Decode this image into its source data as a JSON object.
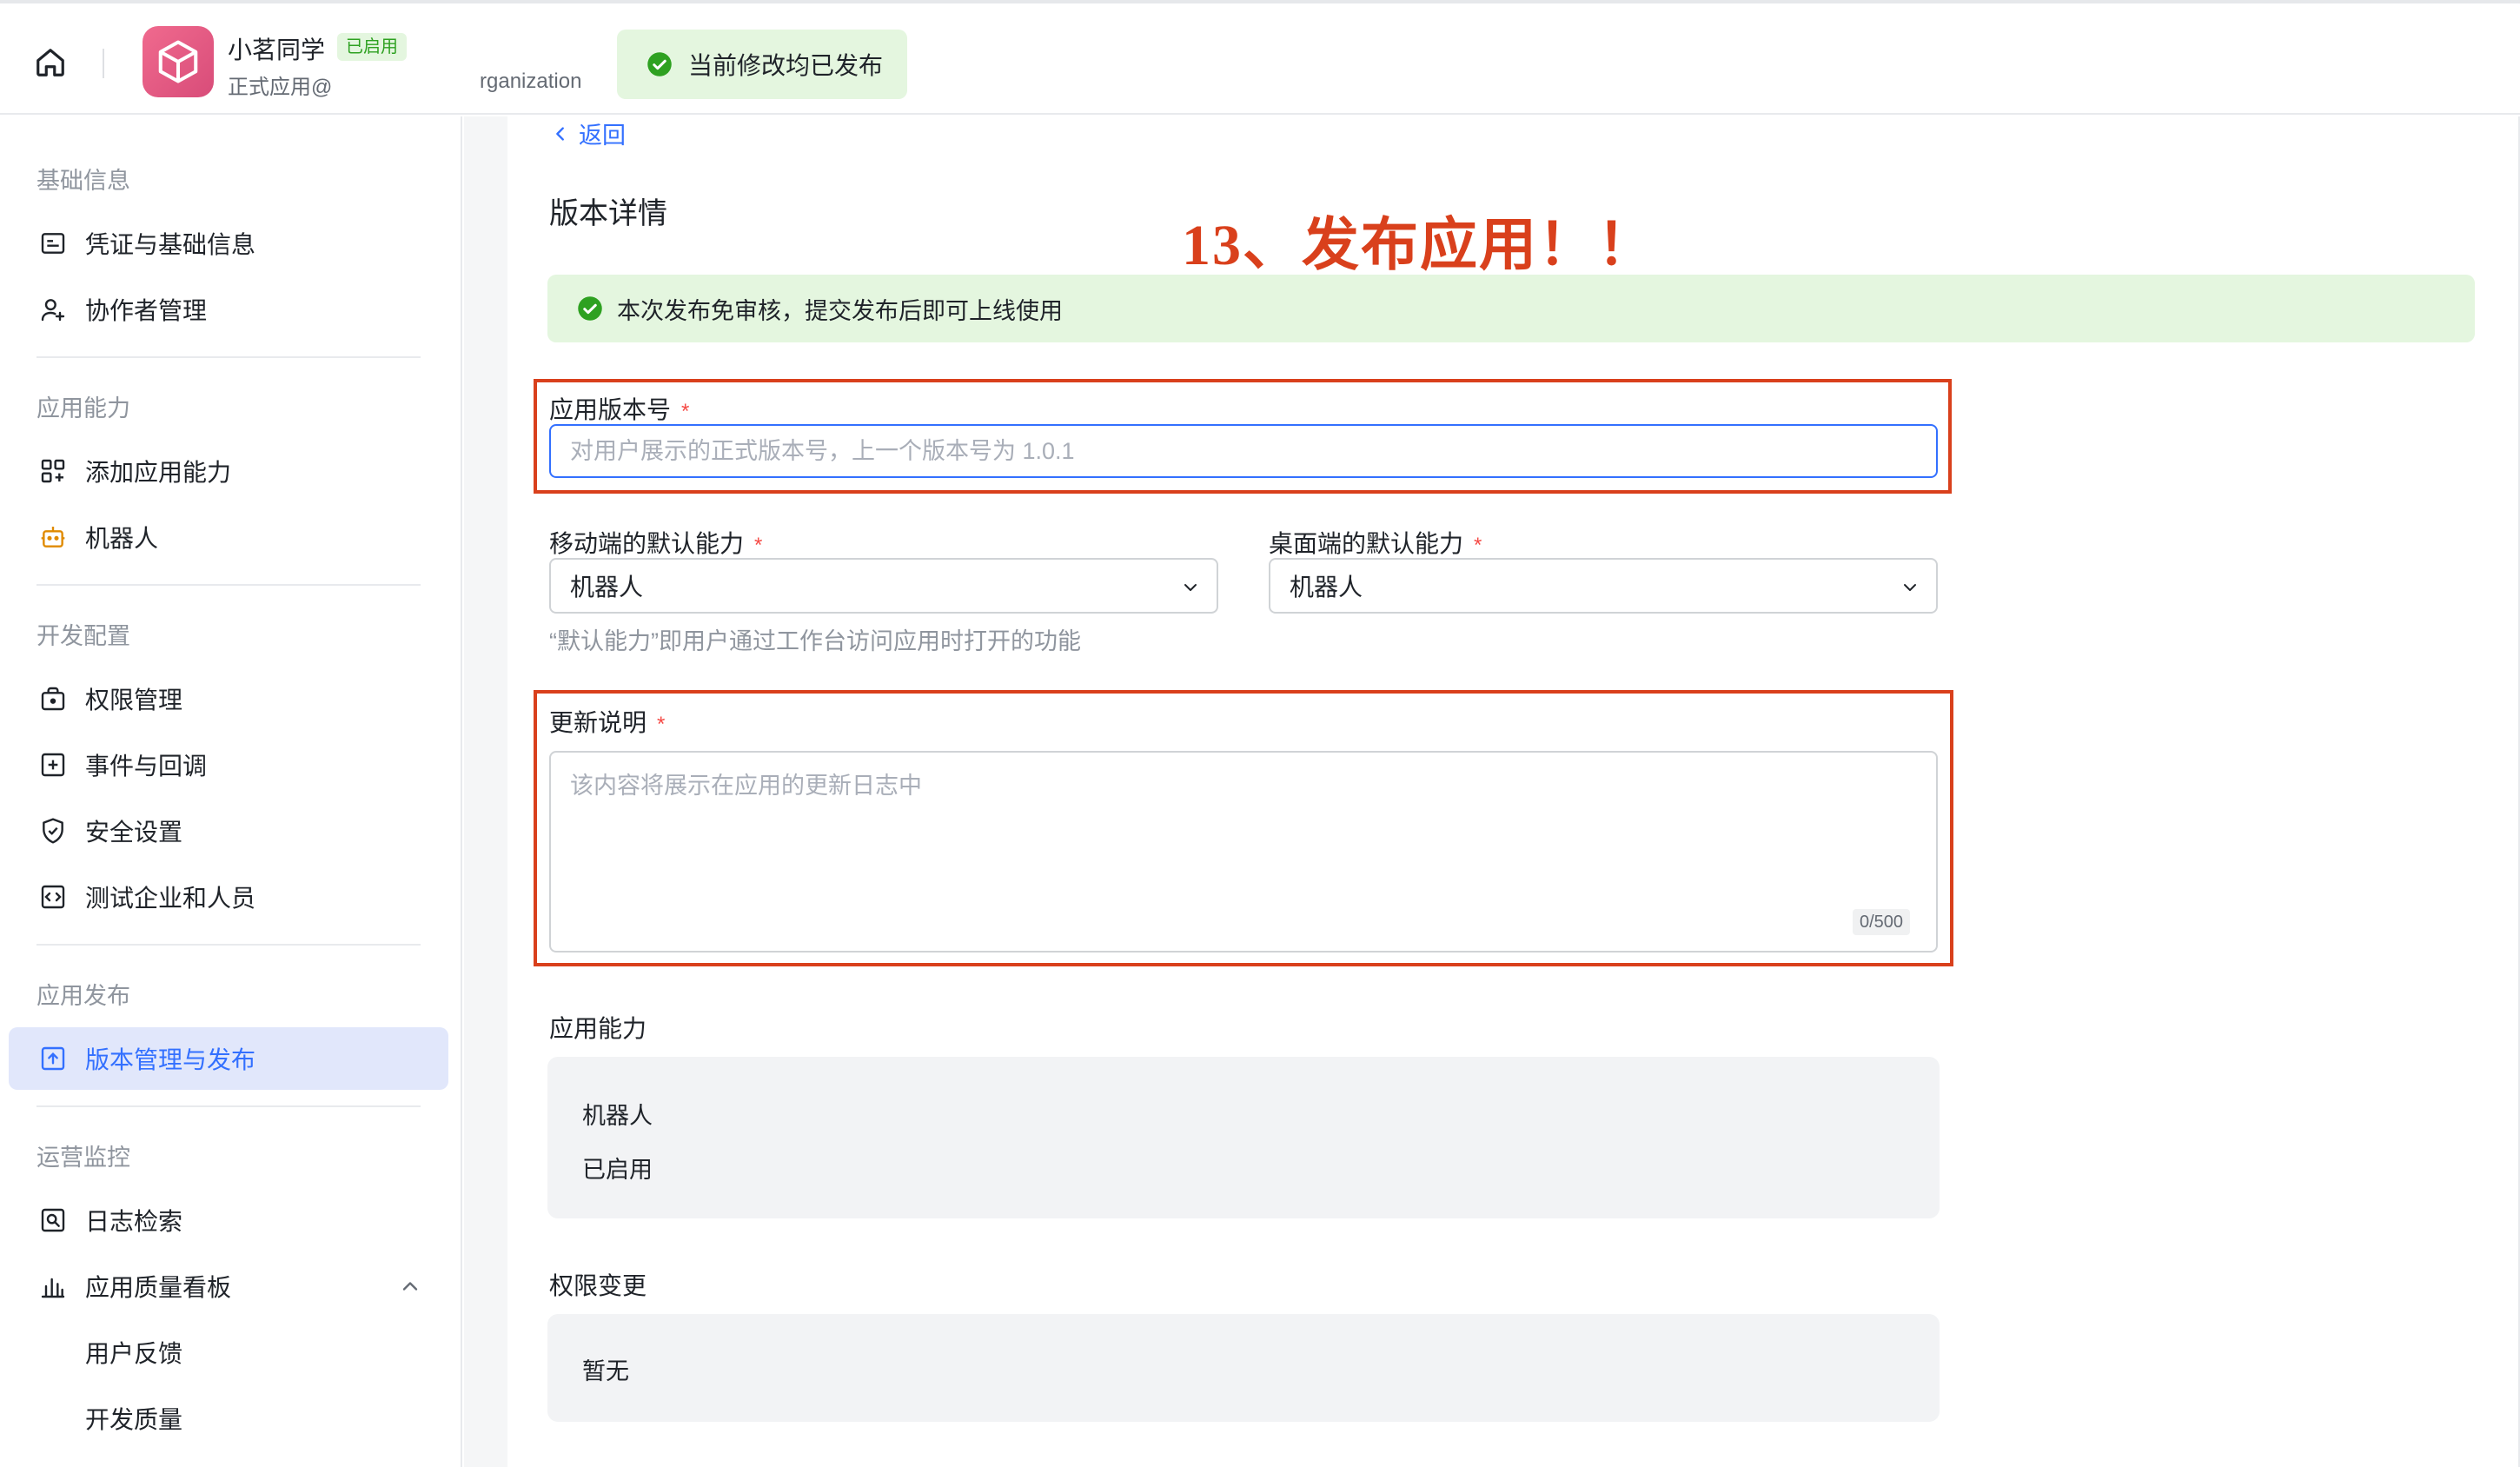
{
  "header": {
    "app_name": "小茗同学",
    "app_status": "已启用",
    "app_subtitle": "正式应用@",
    "org_text": "rganization",
    "publish_status": "当前修改均已发布"
  },
  "sidebar": {
    "sections": [
      {
        "title": "基础信息",
        "items": [
          "凭证与基础信息",
          "协作者管理"
        ]
      },
      {
        "title": "应用能力",
        "items": [
          "添加应用能力",
          "机器人"
        ]
      },
      {
        "title": "开发配置",
        "items": [
          "权限管理",
          "事件与回调",
          "安全设置",
          "测试企业和人员"
        ]
      },
      {
        "title": "应用发布",
        "items": [
          "版本管理与发布"
        ]
      },
      {
        "title": "运营监控",
        "items": [
          "日志检索",
          "应用质量看板"
        ],
        "subitems": [
          "用户反馈",
          "开发质量"
        ]
      }
    ],
    "active_item": "版本管理与发布"
  },
  "main": {
    "back_label": "返回",
    "page_title": "版本详情",
    "annotation": "13、发布应用！！",
    "notice": "本次发布免审核，提交发布后即可上线使用",
    "version": {
      "label": "应用版本号",
      "required_mark": "*",
      "value": "",
      "placeholder": "对用户展示的正式版本号，上一个版本号为 1.0.1"
    },
    "mobile_default": {
      "label": "移动端的默认能力",
      "required_mark": "*",
      "value": "机器人"
    },
    "desktop_default": {
      "label": "桌面端的默认能力",
      "required_mark": "*",
      "value": "机器人"
    },
    "default_hint": "“默认能力”即用户通过工作台访问应用时打开的功能",
    "update_notes": {
      "label": "更新说明",
      "required_mark": "*",
      "value": "",
      "placeholder": "该内容将展示在应用的更新日志中",
      "counter": "0/500"
    },
    "capabilities": {
      "label": "应用能力",
      "name": "机器人",
      "status": "已启用"
    },
    "permissions": {
      "label": "权限变更",
      "value": "暂无"
    }
  },
  "colors": {
    "accent": "#3370ff",
    "success": "#2ea121",
    "success_bg": "#e4f6df",
    "annotation_red": "#d9401c",
    "required_red": "#f54a45"
  },
  "icons": [
    "home-icon",
    "app-logo-icon",
    "check-circle-icon",
    "credential-icon",
    "collaborator-icon",
    "add-capability-icon",
    "robot-icon",
    "permission-icon",
    "event-icon",
    "security-icon",
    "test-icon",
    "version-publish-icon",
    "log-search-icon",
    "quality-board-icon",
    "chevron-down-icon",
    "chevron-up-icon",
    "chevron-left-icon"
  ]
}
